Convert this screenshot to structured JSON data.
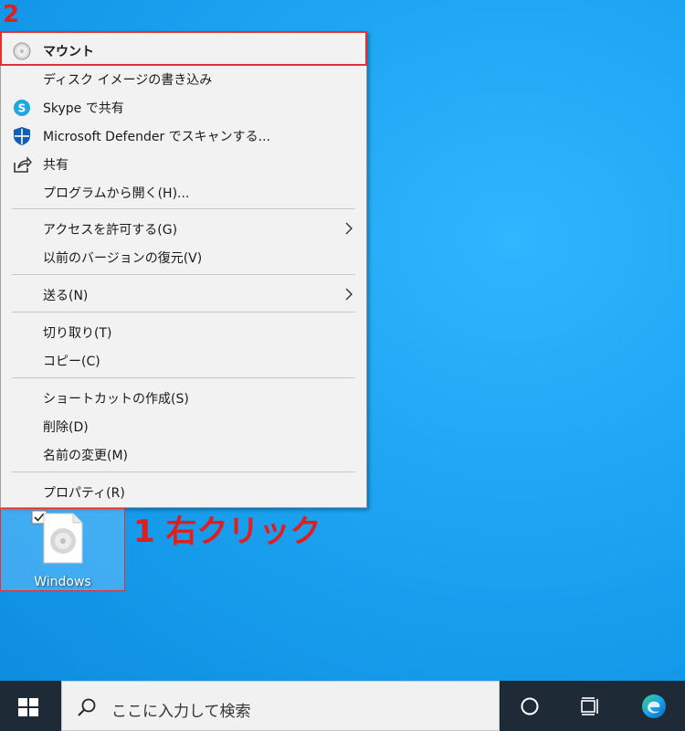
{
  "annotations": {
    "step2": "2",
    "step1": "1 右クリック"
  },
  "context_menu": {
    "items": [
      {
        "label": "マウント",
        "icon": "disc-icon",
        "bold": true
      },
      {
        "label": "ディスク イメージの書き込み"
      },
      {
        "label": "Skype で共有",
        "icon": "skype-icon"
      },
      {
        "label": "Microsoft Defender でスキャンする...",
        "icon": "defender-shield-icon"
      },
      {
        "label": "共有",
        "icon": "share-icon"
      },
      {
        "label": "プログラムから開く(H)..."
      },
      {
        "label": "アクセスを許可する(G)",
        "submenu": true
      },
      {
        "label": "以前のバージョンの復元(V)"
      },
      {
        "label": "送る(N)",
        "submenu": true
      },
      {
        "label": "切り取り(T)"
      },
      {
        "label": "コピー(C)"
      },
      {
        "label": "ショートカットの作成(S)"
      },
      {
        "label": "削除(D)"
      },
      {
        "label": "名前の変更(M)"
      },
      {
        "label": "プロパティ(R)"
      }
    ]
  },
  "desktop_file": {
    "label": "Windows",
    "icon": "disc-image-file-icon",
    "checked": true
  },
  "taskbar": {
    "search_placeholder": "ここに入力して検索",
    "start_icon": "windows-logo-icon",
    "cortana_icon": "cortana-circle-icon",
    "taskview_icon": "task-view-icon",
    "edge_icon": "edge-icon"
  },
  "colors": {
    "annotation_red": "#e01e1e",
    "desktop_blue": "#1ca4f2",
    "taskbar": "#1e2a36"
  }
}
